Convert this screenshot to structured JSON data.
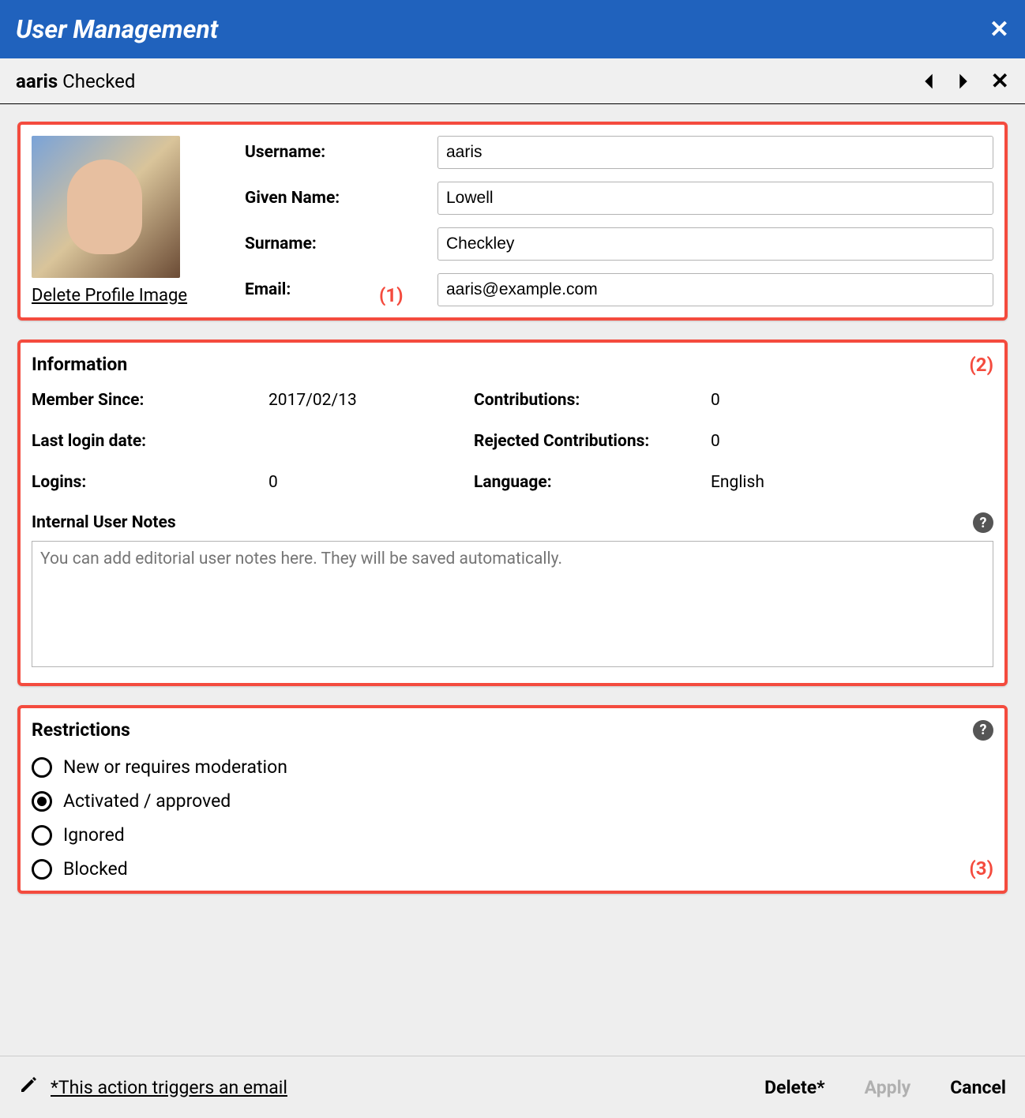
{
  "header": {
    "title": "User Management"
  },
  "subheader": {
    "username": "aaris",
    "status": "Checked"
  },
  "annotations": {
    "a1": "(1)",
    "a2": "(2)",
    "a3": "(3)"
  },
  "profile": {
    "delete_image_label": "Delete Profile Image",
    "labels": {
      "username": "Username:",
      "given_name": "Given Name:",
      "surname": "Surname:",
      "email": "Email:"
    },
    "values": {
      "username": "aaris",
      "given_name": "Lowell",
      "surname": "Checkley",
      "email": "aaris@example.com"
    }
  },
  "information": {
    "heading": "Information",
    "member_since_label": "Member Since:",
    "member_since_value": "2017/02/13",
    "last_login_label": "Last login date:",
    "last_login_value": "",
    "logins_label": "Logins:",
    "logins_value": "0",
    "contributions_label": "Contributions:",
    "contributions_value": "0",
    "rejected_label": "Rejected Contributions:",
    "rejected_value": "0",
    "language_label": "Language:",
    "language_value": "English",
    "notes_heading": "Internal User Notes",
    "notes_placeholder": "You can add editorial user notes here. They will be saved automatically."
  },
  "restrictions": {
    "heading": "Restrictions",
    "options": {
      "o0": "New or requires moderation",
      "o1": "Activated / approved",
      "o2": "Ignored",
      "o3": "Blocked"
    },
    "selected_index": 1
  },
  "footer": {
    "email_note": "*This action triggers an email",
    "delete_label": "Delete*",
    "apply_label": "Apply",
    "cancel_label": "Cancel"
  }
}
